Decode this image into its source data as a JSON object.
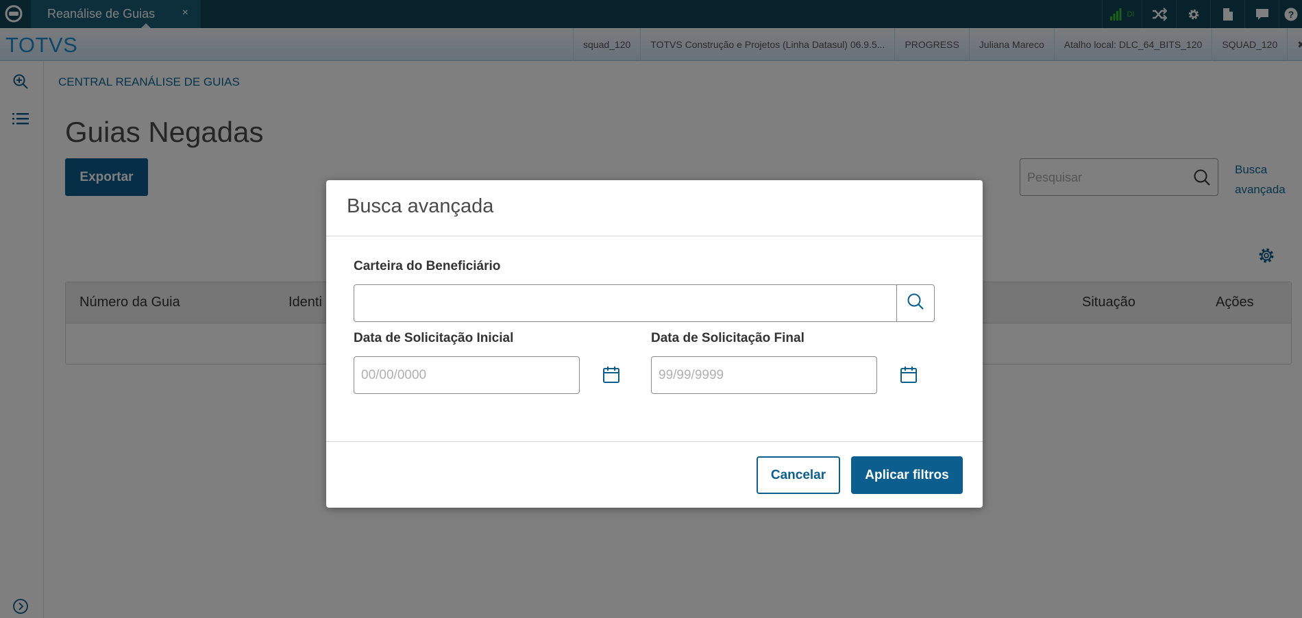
{
  "topbar": {
    "tab_title": "Reanálise de Guias",
    "tab_close": "×",
    "signal_label": "DI"
  },
  "infobar": {
    "brand": "TOTVS",
    "items": [
      "squad_120",
      "TOTVS Construção e Projetos (Linha Datasul) 06.9.5...",
      "PROGRESS",
      "Juliana Mareco",
      "Atalho local: DLC_64_BITS_120",
      "SQUAD_120",
      "✖ Sair"
    ]
  },
  "main": {
    "breadcrumb": "CENTRAL REANÁLISE DE GUIAS",
    "title": "Guias Negadas",
    "export_label": "Exportar",
    "search_placeholder": "Pesquisar",
    "advanced_link": "Busca avançada",
    "table_headers": {
      "numero": "Número da Guia",
      "identi": "Identi",
      "situacao": "Situação",
      "acoes": "Ações"
    }
  },
  "modal": {
    "title": "Busca avançada",
    "wallet_label": "Carteira do Beneficiário",
    "wallet_value": "",
    "start_label": "Data de Solicitação Inicial",
    "start_placeholder": "00/00/0000",
    "end_label": "Data de Solicitação Final",
    "end_placeholder": "99/99/9999",
    "cancel_label": "Cancelar",
    "apply_label": "Aplicar filtros"
  },
  "colors": {
    "topbar": "#0e4457",
    "primary": "#0c5e8e",
    "brand": "#1c8fce",
    "signal": "#38c132"
  },
  "icons": [
    "totvs-logo-icon",
    "shuffle-icon",
    "gear-icon",
    "document-icon",
    "chat-icon",
    "help-icon",
    "zoom-in-icon",
    "list-icon",
    "expand-icon",
    "search-icon",
    "settings-gear-icon",
    "calendar-icon"
  ]
}
